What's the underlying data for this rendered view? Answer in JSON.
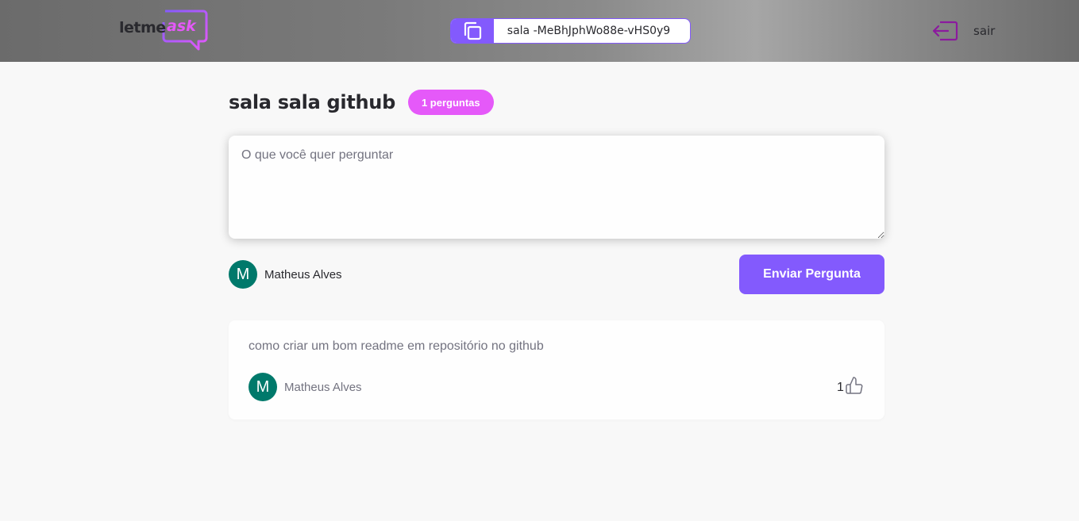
{
  "header": {
    "logo": {
      "prefix": "letme",
      "suffix": "ask"
    },
    "room_code": {
      "text": "sala -MeBhJphWo88e-vHS0y9",
      "icon": "copy-icon"
    },
    "logout": {
      "label": "sair",
      "icon": "logout-icon"
    }
  },
  "room": {
    "title": "sala sala github",
    "badge": "1 perguntas"
  },
  "form": {
    "placeholder": "O que você quer perguntar",
    "value": "",
    "user": {
      "avatar_letter": "M",
      "name": "Matheus Alves"
    },
    "send_label": "Enviar Pergunta"
  },
  "questions": [
    {
      "content": "como criar um bom readme em repositório no github",
      "author": {
        "avatar_letter": "M",
        "name": "Matheus Alves"
      },
      "like_count": "1",
      "like_icon": "thumbs-up-icon"
    }
  ],
  "colors": {
    "primary": "#835afd",
    "pink": "#e559f9",
    "avatar": "#00796b",
    "text": "#29292e",
    "muted": "#737380"
  }
}
